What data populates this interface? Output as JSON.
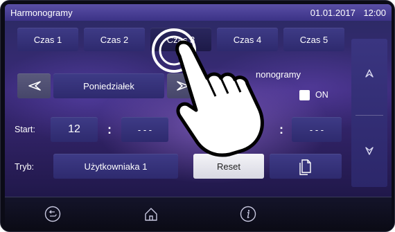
{
  "header": {
    "title": "Harmonogramy",
    "date": "01.01.2017",
    "time": "12:00"
  },
  "tabs": [
    {
      "label": "Czas 1"
    },
    {
      "label": "Czas 2"
    },
    {
      "label": "Czas 3"
    },
    {
      "label": "Czas 4"
    },
    {
      "label": "Czas 5"
    }
  ],
  "day_selector": {
    "value": "Poniedziałek"
  },
  "schedule": {
    "label": "nonogramy",
    "checkbox_label": "ON",
    "checked": false
  },
  "start": {
    "label": "Start:",
    "hour": "12",
    "sep": ":",
    "minute": "- - -",
    "end_sep": ":",
    "end_value": "- - -"
  },
  "mode": {
    "label": "Tryb:",
    "value": "Użytkowniaka 1",
    "reset_label": "Reset"
  },
  "icons": {
    "prev": "chevron-left-icon",
    "next": "chevron-right-icon",
    "up": "chevron-up-icon",
    "down": "chevron-down-icon",
    "copy": "copy-icon",
    "back": "back-icon",
    "home": "home-icon",
    "info": "info-icon"
  },
  "colors": {
    "accent": "#3e3b86",
    "topbar": "#4a4096",
    "screen": "#2f2a70"
  }
}
